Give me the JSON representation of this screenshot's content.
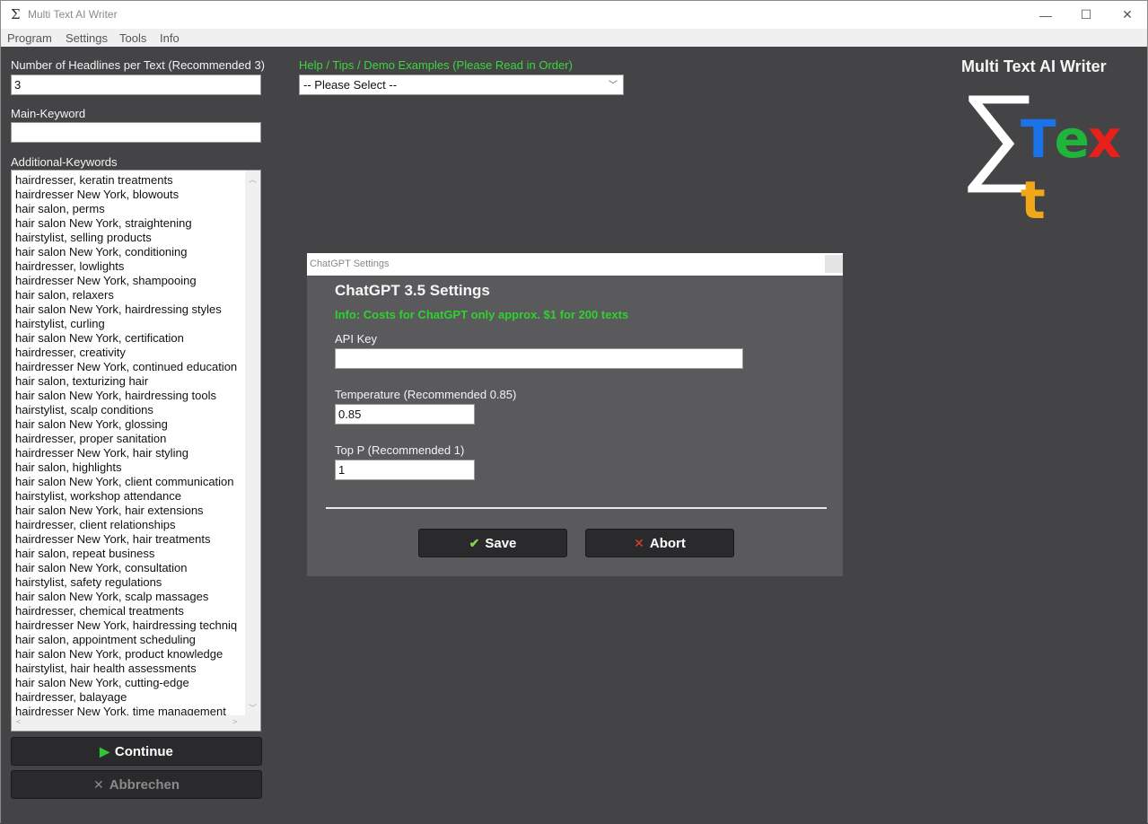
{
  "window": {
    "title": "Multi Text AI Writer",
    "app_icon": "Σ",
    "controls": {
      "minimize": "—",
      "maximize": "☐",
      "close": "✕"
    }
  },
  "menu": [
    "Program",
    "Settings",
    "Tools",
    "Info"
  ],
  "form": {
    "headlines": {
      "label": "Number of Headlines per Text (Recommended 3)",
      "value": "3"
    },
    "main_keyword": {
      "label": "Main-Keyword",
      "value": ""
    },
    "additional_keywords": {
      "label": "Additional-Keywords",
      "items": [
        "hairdresser, keratin treatments",
        "hairdresser New York, blowouts",
        "hair salon, perms",
        "hair salon New York, straightening",
        "hairstylist, selling products",
        "hair salon New York, conditioning",
        "hairdresser, lowlights",
        "hairdresser New York, shampooing",
        "hair salon, relaxers",
        "hair salon New York, hairdressing styles",
        "hairstylist, curling",
        "hair salon New York, certification",
        "hairdresser, creativity",
        "hairdresser New York, continued education",
        "hair salon, texturizing hair",
        "hair salon New York, hairdressing tools",
        "hairstylist, scalp conditions",
        "hair salon New York, glossing",
        "hairdresser, proper sanitation",
        "hairdresser New York, hair styling",
        "hair salon, highlights",
        "hair salon New York, client communication",
        "hairstylist, workshop attendance",
        "hair salon New York, hair extensions",
        "hairdresser, client relationships",
        "hairdresser New York, hair treatments",
        "hair salon, repeat business",
        "hair salon New York, consultation",
        "hairstylist, safety regulations",
        "hair salon New York, scalp massages",
        "hairdresser, chemical treatments",
        "hairdresser New York, hairdressing techniq",
        "hair salon, appointment scheduling",
        "hair salon New York, product knowledge",
        "hairstylist, hair health assessments",
        "hair salon New York, cutting-edge",
        "hairdresser, balayage",
        "hairdresser New York, time management"
      ]
    },
    "help": {
      "label": "Help / Tips / Demo Examples (Please Read in Order)",
      "selected": "-- Please Select --"
    },
    "continue_button": {
      "label": "Continue",
      "icon": "▶"
    },
    "cancel_button": {
      "label": "Abbrechen",
      "icon": "✕"
    }
  },
  "logo": {
    "title": "Multi Text AI Writer",
    "sigma": "∑",
    "letters": [
      {
        "char": "T",
        "color": "#1a73e8"
      },
      {
        "char": "e",
        "color": "#1fb53a"
      },
      {
        "char": "x",
        "color": "#e8201a"
      },
      {
        "char": "t",
        "color": "#f0a818"
      }
    ]
  },
  "dialog": {
    "window_title": "ChatGPT Settings",
    "heading": "ChatGPT 3.5 Settings",
    "info": "Info: Costs for ChatGPT only approx. $1 for 200 texts",
    "api_key": {
      "label": "API Key",
      "value": ""
    },
    "temperature": {
      "label": "Temperature (Recommended 0.85)",
      "value": "0.85"
    },
    "top_p": {
      "label": "Top P (Recommended 1)",
      "value": "1"
    },
    "save_button": {
      "label": "Save",
      "icon": "✔"
    },
    "abort_button": {
      "label": "Abort",
      "icon": "✕"
    }
  },
  "colors": {
    "accent_green": "#3fd43f",
    "save_check": "#8fd14f",
    "abort_x": "#e0402a"
  }
}
